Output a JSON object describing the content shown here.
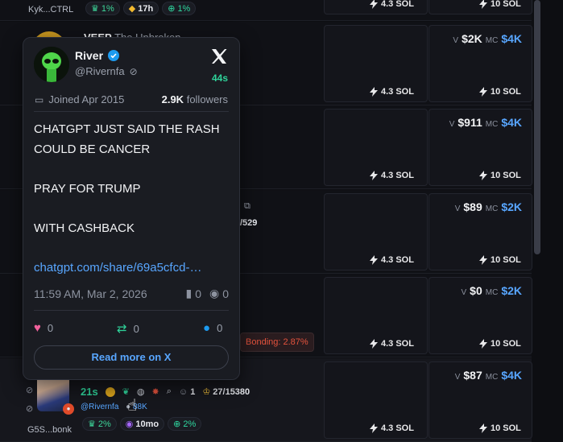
{
  "rows": [
    {
      "id": "r0",
      "top_label": "Kyk...CTRL",
      "pills": [
        "1%",
        "17h",
        "1%"
      ],
      "buy1": "4.3 SOL",
      "buy2": "10 SOL",
      "volume": "",
      "mc": ""
    },
    {
      "id": "r1",
      "ticker": "VEEP",
      "name": "The Unbroken",
      "volume": "$2K",
      "mc": "$4K",
      "buy1": "4.3 SOL",
      "buy2": "10 SOL"
    },
    {
      "id": "r2",
      "volume": "$911",
      "mc": "$4K",
      "buy1": "4.3 SOL",
      "buy2": "10 SOL"
    },
    {
      "id": "r3",
      "holders_text": "/529",
      "volume": "$89",
      "mc": "$2K",
      "buy1": "4.3 SOL",
      "buy2": "10 SOL"
    },
    {
      "id": "r4",
      "volume": "$0",
      "mc": "$2K",
      "buy1": "4.3 SOL",
      "buy2": "10 SOL",
      "bonding": "Bonding: 2.87%"
    },
    {
      "id": "r5",
      "age": "21s",
      "handle": "@Rivernfa",
      "followers": "88K",
      "holders": "1",
      "crown": "27/15380",
      "pill1": "2%",
      "pill2": "10mo",
      "pill3": "2%",
      "bottom_label": "G5S...bonk",
      "volume": "$87",
      "mc": "$4K",
      "buy1": "4.3 SOL",
      "buy2": "10 SOL"
    }
  ],
  "labels": {
    "volume": "V",
    "mc": "MC"
  },
  "popup": {
    "name": "River",
    "handle": "@Rivernfa",
    "age": "44s",
    "joined": "Joined Apr 2015",
    "followers_count": "2.9K",
    "followers_label": "followers",
    "tweet_lines": [
      "CHATGPT JUST SAID THE RASH COULD BE CANCER",
      "PRAY FOR TRUMP",
      "WITH CASHBACK"
    ],
    "link": "chatgpt.com/share/69a5cfcd-…",
    "timestamp": "11:59 AM, Mar 2, 2026",
    "bookmarks": "0",
    "views": "0",
    "likes": "0",
    "retweets": "0",
    "replies": "0",
    "read_more": "Read more on X"
  },
  "colors": {
    "accent": "#58a6ff",
    "green": "#2fd39a",
    "bonding": "#e5533d"
  }
}
